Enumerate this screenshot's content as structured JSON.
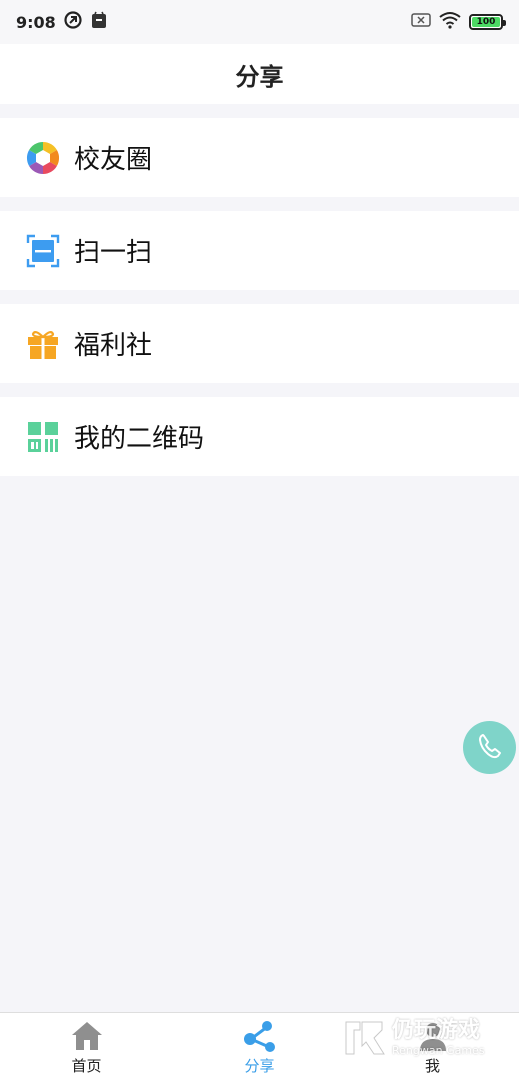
{
  "status_bar": {
    "time": "9:08",
    "battery": "100"
  },
  "header": {
    "title": "分享"
  },
  "menu": {
    "items": [
      {
        "label": "校友圈",
        "icon": "aperture-icon"
      },
      {
        "label": "扫一扫",
        "icon": "scan-icon"
      },
      {
        "label": "福利社",
        "icon": "gift-icon"
      },
      {
        "label": "我的二维码",
        "icon": "qrcode-icon"
      }
    ]
  },
  "tabbar": {
    "tabs": [
      {
        "label": "首页",
        "icon": "home-icon",
        "active": false
      },
      {
        "label": "分享",
        "icon": "share-icon",
        "active": true
      },
      {
        "label": "我",
        "icon": "user-icon",
        "active": false
      }
    ]
  },
  "watermark": {
    "cn": "仍玩游戏",
    "en": "Rengwan Games"
  },
  "colors": {
    "accent": "#3a9ee8",
    "call_button": "#7fd4c9",
    "gift": "#f6a623",
    "qrcode": "#5ad19a",
    "scan": "#3d9cf0"
  }
}
